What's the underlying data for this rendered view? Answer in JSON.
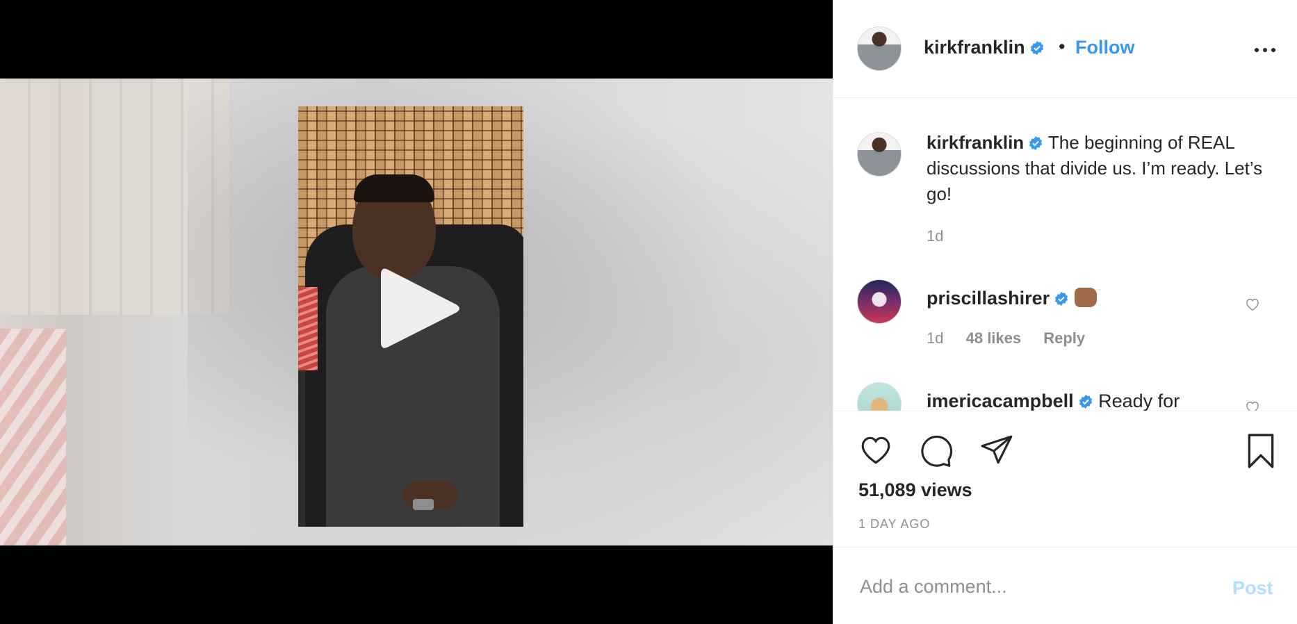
{
  "post": {
    "author": {
      "username": "kirkfranklin",
      "verified": true,
      "follow_label": "Follow",
      "separator": "•"
    },
    "caption": {
      "username": "kirkfranklin",
      "text": " The beginning of REAL discussions that divide us. I’m ready. Let’s go!",
      "time": "1d"
    },
    "comments": [
      {
        "username": "priscillashirer",
        "verified": true,
        "text": "",
        "emoji": "fist-bump-emoji",
        "time": "1d",
        "likes": "48 likes",
        "reply_label": "Reply"
      },
      {
        "username": "imericacampbell",
        "verified": true,
        "text": " Ready for"
      }
    ],
    "views": "51,089 views",
    "posted_ago": "1 DAY AGO",
    "add_comment": {
      "placeholder": "Add a comment...",
      "post_label": "Post"
    }
  },
  "icons": {
    "verified": "verified-badge-icon",
    "more": "more-options-icon",
    "like": "heart-icon",
    "comment": "comment-bubble-icon",
    "share": "paper-plane-icon",
    "save": "bookmark-icon",
    "play": "play-icon"
  },
  "colors": {
    "accent": "#3897f0",
    "post_disabled": "#b2dffc",
    "muted": "#8e8e8e",
    "text": "#262626"
  }
}
